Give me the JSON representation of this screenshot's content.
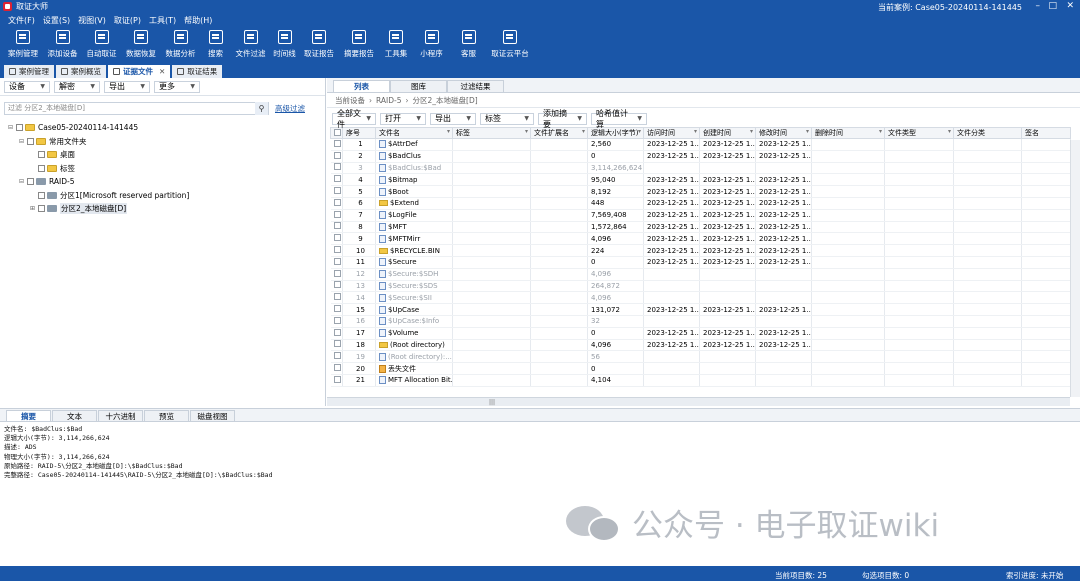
{
  "window": {
    "title": "取证大师",
    "current_case_label": "当前案例: Case05-20240114-141445"
  },
  "menu": [
    "文件(F)",
    "设置(S)",
    "视图(V)",
    "取证(P)",
    "工具(T)",
    "帮助(H)"
  ],
  "toolbar": [
    {
      "label": "案例管理",
      "icon": "folder-icon"
    },
    {
      "label": "添加设备",
      "icon": "add-device-icon"
    },
    {
      "label": "自动取证",
      "icon": "monitor-icon"
    },
    {
      "label": "数据恢复",
      "icon": "recover-icon"
    },
    {
      "label": "数据分析",
      "icon": "analysis-icon"
    },
    {
      "label": "搜索",
      "icon": "search-icon"
    },
    {
      "label": "文件过滤",
      "icon": "filter-icon"
    },
    {
      "label": "时间线",
      "icon": "timeline-icon"
    },
    {
      "label": "取证报告",
      "icon": "report-icon"
    },
    {
      "label": "摘要报告",
      "icon": "summary-report-icon"
    },
    {
      "label": "工具集",
      "icon": "tools-icon"
    },
    {
      "label": "小程序",
      "icon": "miniapp-icon"
    },
    {
      "label": "客服",
      "icon": "support-icon"
    },
    {
      "label": "取证云平台",
      "icon": "cloud-icon"
    }
  ],
  "tabs": [
    {
      "label": "案例管理",
      "active": false,
      "closable": false
    },
    {
      "label": "案例概览",
      "active": false,
      "closable": false
    },
    {
      "label": "证据文件",
      "active": true,
      "closable": true
    },
    {
      "label": "取证结果",
      "active": false,
      "closable": false
    }
  ],
  "left": {
    "dropdowns": [
      "设备",
      "解密",
      "导出",
      "更多"
    ],
    "filter_text": "过滤 分区2_本地磁盘[D]",
    "advanced_filter": "高级过滤",
    "tree": [
      {
        "label": "Case05-20240114-141445",
        "level": 0,
        "type": "folder",
        "expanded": true
      },
      {
        "label": "常用文件夹",
        "level": 1,
        "type": "folder",
        "expanded": true
      },
      {
        "label": "桌面",
        "level": 2,
        "type": "folder"
      },
      {
        "label": "标签",
        "level": 2,
        "type": "folder"
      },
      {
        "label": "RAID-5",
        "level": 1,
        "type": "disk",
        "expanded": true
      },
      {
        "label": "分区1[Microsoft reserved partition]",
        "level": 2,
        "type": "disk"
      },
      {
        "label": "分区2_本地磁盘[D]",
        "level": 2,
        "type": "disk",
        "selected": true
      }
    ]
  },
  "right": {
    "view_tabs": [
      {
        "label": "列表",
        "active": true
      },
      {
        "label": "图库",
        "active": false
      },
      {
        "label": "过滤结果",
        "active": false
      }
    ],
    "breadcrumb": [
      "当前设备",
      "RAID-5",
      "分区2_本地磁盘[D]"
    ],
    "grid_toolbar": [
      "全部文件",
      "打开",
      "导出",
      "标签",
      "添加摘要",
      "哈希值计算"
    ],
    "columns": [
      "序号",
      "文件名",
      "标签",
      "文件扩展名",
      "逻辑大小(字节)",
      "访问时间",
      "创建时间",
      "修改时间",
      "删除时间",
      "文件类型",
      "文件分类",
      "签名"
    ],
    "rows": [
      {
        "no": "1",
        "name": "$AttrDef",
        "size": "2,560",
        "atime": "2023-12-25 1...",
        "ctime": "2023-12-25 1...",
        "mtime": "2023-12-25 1...",
        "icon": "file",
        "deleted": false
      },
      {
        "no": "2",
        "name": "$BadClus",
        "size": "0",
        "atime": "2023-12-25 1...",
        "ctime": "2023-12-25 1...",
        "mtime": "2023-12-25 1...",
        "icon": "file",
        "deleted": false
      },
      {
        "no": "3",
        "name": "$BadClus:$Bad",
        "size": "3,114,266,624",
        "atime": "",
        "ctime": "",
        "mtime": "",
        "icon": "file",
        "deleted": true
      },
      {
        "no": "4",
        "name": "$Bitmap",
        "size": "95,040",
        "atime": "2023-12-25 1...",
        "ctime": "2023-12-25 1...",
        "mtime": "2023-12-25 1...",
        "icon": "file",
        "deleted": false
      },
      {
        "no": "5",
        "name": "$Boot",
        "size": "8,192",
        "atime": "2023-12-25 1...",
        "ctime": "2023-12-25 1...",
        "mtime": "2023-12-25 1...",
        "icon": "file",
        "deleted": false
      },
      {
        "no": "6",
        "name": "$Extend",
        "size": "448",
        "atime": "2023-12-25 1...",
        "ctime": "2023-12-25 1...",
        "mtime": "2023-12-25 1...",
        "icon": "folder",
        "deleted": false
      },
      {
        "no": "7",
        "name": "$LogFile",
        "size": "7,569,408",
        "atime": "2023-12-25 1...",
        "ctime": "2023-12-25 1...",
        "mtime": "2023-12-25 1...",
        "icon": "file",
        "deleted": false
      },
      {
        "no": "8",
        "name": "$MFT",
        "size": "1,572,864",
        "atime": "2023-12-25 1...",
        "ctime": "2023-12-25 1...",
        "mtime": "2023-12-25 1...",
        "icon": "file",
        "deleted": false
      },
      {
        "no": "9",
        "name": "$MFTMirr",
        "size": "4,096",
        "atime": "2023-12-25 1...",
        "ctime": "2023-12-25 1...",
        "mtime": "2023-12-25 1...",
        "icon": "file",
        "deleted": false
      },
      {
        "no": "10",
        "name": "$RECYCLE.BIN",
        "size": "224",
        "atime": "2023-12-25 1...",
        "ctime": "2023-12-25 1...",
        "mtime": "2023-12-25 1...",
        "icon": "folder",
        "deleted": false
      },
      {
        "no": "11",
        "name": "$Secure",
        "size": "0",
        "atime": "2023-12-25 1...",
        "ctime": "2023-12-25 1...",
        "mtime": "2023-12-25 1...",
        "icon": "file",
        "deleted": false
      },
      {
        "no": "12",
        "name": "$Secure:$SDH",
        "size": "4,096",
        "atime": "",
        "ctime": "",
        "mtime": "",
        "icon": "file",
        "deleted": true
      },
      {
        "no": "13",
        "name": "$Secure:$SDS",
        "size": "264,872",
        "atime": "",
        "ctime": "",
        "mtime": "",
        "icon": "file",
        "deleted": true
      },
      {
        "no": "14",
        "name": "$Secure:$SII",
        "size": "4,096",
        "atime": "",
        "ctime": "",
        "mtime": "",
        "icon": "file",
        "deleted": true
      },
      {
        "no": "15",
        "name": "$UpCase",
        "size": "131,072",
        "atime": "2023-12-25 1...",
        "ctime": "2023-12-25 1...",
        "mtime": "2023-12-25 1...",
        "icon": "file",
        "deleted": false
      },
      {
        "no": "16",
        "name": "$UpCase:$Info",
        "size": "32",
        "atime": "",
        "ctime": "",
        "mtime": "",
        "icon": "file",
        "deleted": true
      },
      {
        "no": "17",
        "name": "$Volume",
        "size": "0",
        "atime": "2023-12-25 1...",
        "ctime": "2023-12-25 1...",
        "mtime": "2023-12-25 1...",
        "icon": "file",
        "deleted": false
      },
      {
        "no": "18",
        "name": "(Root directory)",
        "size": "4,096",
        "atime": "2023-12-25 1...",
        "ctime": "2023-12-25 1...",
        "mtime": "2023-12-25 1...",
        "icon": "folder",
        "deleted": false
      },
      {
        "no": "19",
        "name": "(Root directory):...",
        "size": "56",
        "atime": "",
        "ctime": "",
        "mtime": "",
        "icon": "file",
        "deleted": true
      },
      {
        "no": "20",
        "name": "丢失文件",
        "size": "0",
        "atime": "",
        "ctime": "",
        "mtime": "",
        "icon": "lost",
        "deleted": false
      },
      {
        "no": "21",
        "name": "MFT Allocation Bit...",
        "size": "4,104",
        "atime": "",
        "ctime": "",
        "mtime": "",
        "icon": "file",
        "deleted": false
      }
    ]
  },
  "bottom": {
    "tabs": [
      {
        "label": "摘要",
        "active": true
      },
      {
        "label": "文本",
        "active": false
      },
      {
        "label": "十六进制",
        "active": false
      },
      {
        "label": "预览",
        "active": false
      },
      {
        "label": "磁盘视图",
        "active": false
      }
    ],
    "info_lines": [
      "文件名: $BadClus:$Bad",
      "逻辑大小(字节): 3,114,266,624",
      "描述: ADS",
      "物理大小(字节): 3,114,266,624",
      "原始路径: RAID-5\\分区2_本地磁盘[D]:\\$BadClus:$Bad",
      "完整路径: Case05-20240114-141445\\RAID-5\\分区2_本地磁盘[D]:\\$BadClus:$Bad"
    ]
  },
  "watermark": "公众号 · 电子取证wiki",
  "status": {
    "current_items": "当前项目数: 25",
    "checked_items": "勾选项目数: 0",
    "index_progress": "索引进度: 未开始"
  }
}
